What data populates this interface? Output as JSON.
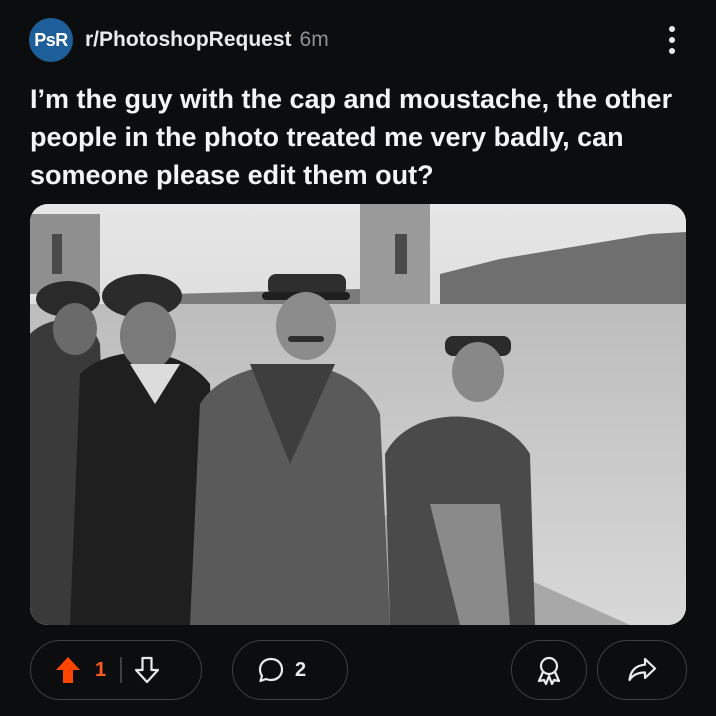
{
  "post": {
    "subreddit_icon_text": "PsR",
    "subreddit": "r/PhotoshopRequest",
    "time_ago": "6m",
    "title": "I’m the guy with the cap and moustache, the other people in the photo treated me very badly, can someone please edit them out?"
  },
  "image": {
    "description": "black-and-white photo of four men walking along a waterfront"
  },
  "actions": {
    "vote_count": "1",
    "comment_count": "2"
  },
  "colors": {
    "upvote": "#ff4500",
    "subreddit_icon_bg": "#1f5f99",
    "background": "#0b0d0e"
  },
  "icons": [
    "more-vertical-icon",
    "upvote-arrow-icon",
    "downvote-arrow-icon",
    "comment-bubble-icon",
    "award-icon",
    "share-arrow-icon"
  ]
}
